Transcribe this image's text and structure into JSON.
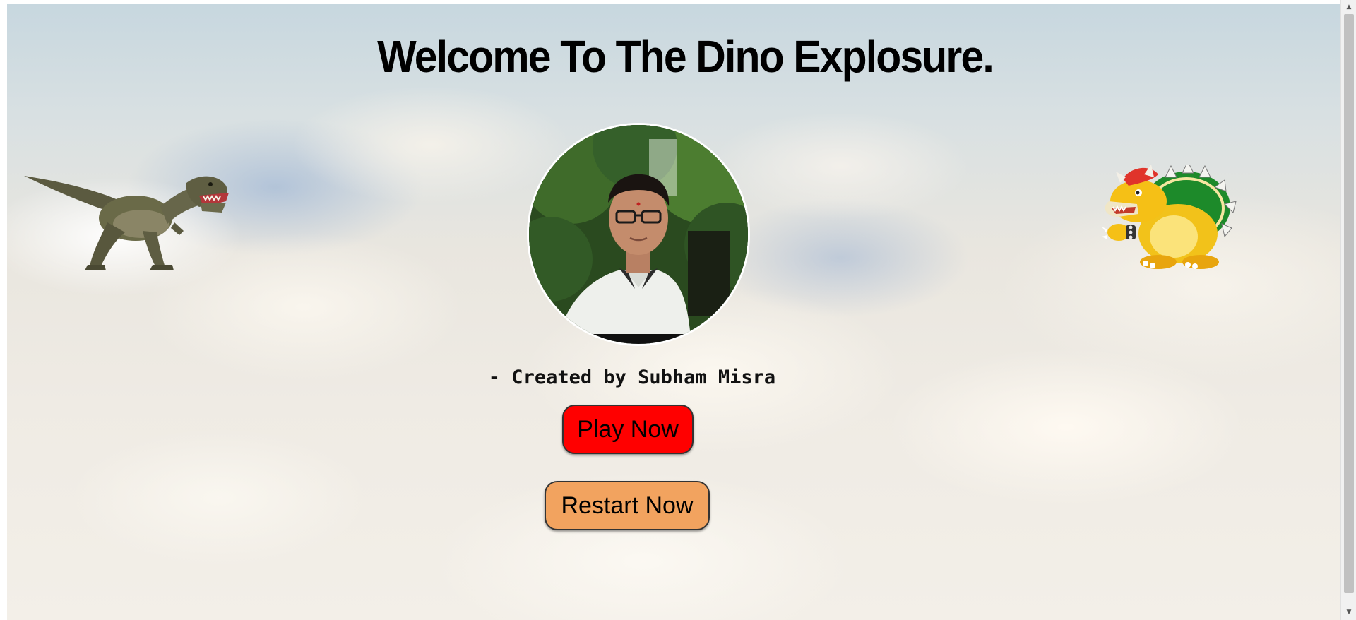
{
  "header": {
    "title": "Welcome To The Dino Explosure."
  },
  "creator": {
    "credit_text": "- Created by Subham Misra"
  },
  "buttons": {
    "play_label": "Play Now",
    "restart_label": "Restart Now"
  },
  "colors": {
    "play_button": "#ff0000",
    "restart_button": "#f2a35f",
    "title_text": "#000000"
  },
  "icons": {
    "left_character": "t-rex-dinosaur-icon",
    "right_character": "bowser-character-icon",
    "profile": "creator-profile-photo"
  },
  "scrollbar": {
    "up_arrow": "▲",
    "down_arrow": "▼"
  }
}
